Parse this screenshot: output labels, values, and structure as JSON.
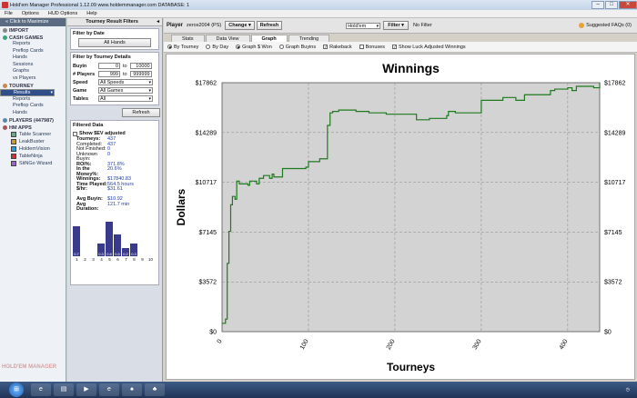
{
  "window": {
    "title": "Hold'em Manager Professional 1.12.09    www.holdemmanager.com    DATABASE: 1"
  },
  "menu": [
    "File",
    "Options",
    "HUD Options",
    "Help"
  ],
  "nav": {
    "header": "Click to Maximize",
    "import": "IMPORT",
    "cash_games": "CASH GAMES",
    "cash_items": [
      "Reports",
      "Preflop Cards",
      "Hands",
      "Sessions",
      "Graphs",
      "vs Players"
    ],
    "tourney": "TOURNEY",
    "tourney_items": [
      "Results",
      "Reports",
      "Preflop Cards",
      "Hands"
    ],
    "players": "PLAYERS (447987)",
    "hm_apps": "HM APPS",
    "apps": [
      "Table Scanner",
      "LeakBuster",
      "HoldemVision",
      "TableNinja",
      "SitNGo Wizard"
    ],
    "logo": "HOLD'EM MANAGER"
  },
  "filters": {
    "header": "Tourney Result Filters",
    "by_date": "Filter by Date",
    "all_hands": "All Hands",
    "by_details": "Filter by Tourney Details",
    "buyin_label": "Buyin",
    "buyin_from": "0",
    "to1": "to",
    "buyin_to": "10000",
    "players_label": "# Players",
    "players_from": "999",
    "to2": "to",
    "players_to": "999999",
    "speed_label": "Speed",
    "speed_value": "All Speeds",
    "game_label": "Game",
    "game_value": "All Games",
    "tables_label": "Tables",
    "tables_value": "All",
    "refresh": "Refresh",
    "filtered_data": "Filtered Data",
    "show_ev": "Show $EV adjusted",
    "stats": [
      {
        "k": "Tourneys:",
        "v": "437",
        "b": true
      },
      {
        "k": "Completed:",
        "v": "437",
        "b": false
      },
      {
        "k": "Not Finished:",
        "v": "0",
        "b": false
      },
      {
        "k": "Unknown Buyin:",
        "v": "0",
        "b": false
      },
      {
        "k": "",
        "v": "",
        "b": false
      },
      {
        "k": "ROI%:",
        "v": "371.8%",
        "b": true
      },
      {
        "k": "In the Money%:",
        "v": "20.6%",
        "b": true
      },
      {
        "k": "",
        "v": "",
        "b": false
      },
      {
        "k": "Winnings:",
        "v": "$17840.83",
        "b": true
      },
      {
        "k": "Time Played:",
        "v": "564.5 hours",
        "b": true
      },
      {
        "k": "$/hr:",
        "v": "$31.61",
        "b": true
      },
      {
        "k": "",
        "v": "",
        "b": false
      },
      {
        "k": "Avg Buyin:",
        "v": "$10.92",
        "b": true
      },
      {
        "k": "Avg Duration:",
        "v": "121.7 min",
        "b": true
      }
    ],
    "mini_bars": [
      {
        "label": "0.7",
        "value": 0.7
      },
      {
        "label": "",
        "value": 0
      },
      {
        "label": "",
        "value": 0
      },
      {
        "label": "0.3",
        "value": 0.3
      },
      {
        "label": "0.8",
        "value": 0.8
      },
      {
        "label": "0.5",
        "value": 0.5
      },
      {
        "label": "0.2",
        "value": 0.2
      },
      {
        "label": "0.3",
        "value": 0.3
      },
      {
        "label": "",
        "value": 0
      }
    ],
    "mini_ticks": [
      "1",
      "2",
      "3",
      "4",
      "5",
      "6",
      "7",
      "8",
      "9",
      "10"
    ]
  },
  "playerbar": {
    "label": "Player",
    "name": "zeros2004 (PS)",
    "change": "Change",
    "refresh": "Refresh",
    "site": "Hold'em",
    "filter": "Filter",
    "no_filter": "No Filter",
    "faqs": "Suggested FAQs (0)"
  },
  "tabs": [
    "Stats",
    "Data View",
    "Graph",
    "Trending"
  ],
  "active_tab": "Graph",
  "options": [
    {
      "type": "radio",
      "label": "By Tourney",
      "on": true
    },
    {
      "type": "radio",
      "label": "By Day",
      "on": false
    },
    {
      "type": "radio",
      "label": "Graph $ Won",
      "on": true
    },
    {
      "type": "radio",
      "label": "Graph Buyins",
      "on": false
    },
    {
      "type": "check",
      "label": "Rakeback",
      "on": true
    },
    {
      "type": "check",
      "label": "Bonuses",
      "on": false
    },
    {
      "type": "check",
      "label": "Show Luck Adjusted Winnings",
      "on": true
    }
  ],
  "chart_data": {
    "type": "line",
    "title": "Winnings",
    "xlabel": "Tourneys",
    "ylabel": "Dollars",
    "xlim": [
      0,
      437
    ],
    "ylim": [
      0,
      17862
    ],
    "x_ticks": [
      0,
      100,
      200,
      300,
      400
    ],
    "y_ticks": [
      "$0",
      "$3572",
      "$7145",
      "$10717",
      "$14289",
      "$17862"
    ],
    "y_tick_values": [
      0,
      3572,
      7145,
      10717,
      14289,
      17862
    ],
    "grid": true,
    "series": [
      {
        "color": "#1f7a1f",
        "x": [
          0,
          4,
          6,
          8,
          10,
          12,
          15,
          17,
          20,
          30,
          32,
          40,
          43,
          48,
          55,
          58,
          60,
          70,
          75,
          95,
          97,
          100,
          110,
          113,
          120,
          122,
          125,
          128,
          135,
          150,
          155,
          160,
          170,
          185,
          190,
          200,
          225,
          240,
          260,
          262,
          270,
          280,
          300,
          320,
          325,
          340,
          350,
          370,
          380,
          385,
          400,
          405,
          410,
          420,
          430,
          437
        ],
        "y": [
          600,
          900,
          4900,
          7200,
          9100,
          9700,
          9500,
          10800,
          10600,
          10500,
          10800,
          10600,
          11000,
          11200,
          11000,
          11300,
          11100,
          11700,
          11700,
          11700,
          11800,
          12200,
          12200,
          12400,
          12400,
          14800,
          15700,
          15800,
          15900,
          15900,
          15800,
          15800,
          15700,
          15700,
          15600,
          15600,
          15200,
          15300,
          15500,
          15800,
          15700,
          15700,
          16600,
          16600,
          16800,
          16600,
          17000,
          17000,
          17300,
          17400,
          17500,
          17300,
          17600,
          17600,
          17500,
          17862
        ]
      }
    ]
  }
}
